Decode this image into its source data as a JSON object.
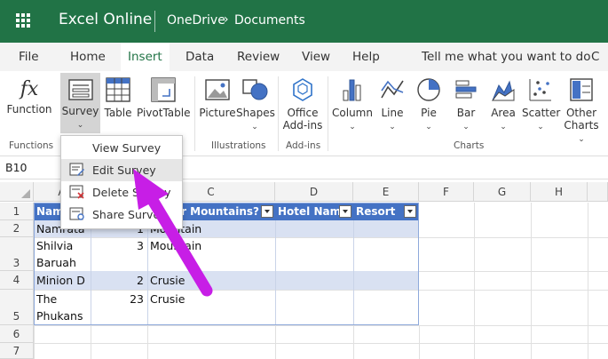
{
  "titlebar": {
    "app_name": "Excel Online",
    "crumb_root": "OneDrive",
    "crumb_separator": "›",
    "crumb_current": "Documents",
    "background": "#217346"
  },
  "tabs": [
    "File",
    "Home",
    "Insert",
    "Data",
    "Review",
    "View",
    "Help"
  ],
  "active_tab": "Insert",
  "tell_me": "Tell me what you want to do",
  "tell_me_trail": "C",
  "ribbon": {
    "function": "Function",
    "survey": "Survey",
    "table": "Table",
    "pivottable": "PivotTable",
    "picture": "Picture",
    "shapes": "Shapes",
    "office_addins_1": "Office",
    "office_addins_2": "Add-ins",
    "column": "Column",
    "line": "Line",
    "pie": "Pie",
    "bar": "Bar",
    "area": "Area",
    "scatter": "Scatter",
    "other_charts_1": "Other",
    "other_charts_2": "Charts",
    "fx_glyph": "fx",
    "caret": "⌄",
    "groups": {
      "functions": "Functions",
      "illustrations": "Illustrations",
      "addins": "Add-ins",
      "charts": "Charts"
    }
  },
  "survey_menu": {
    "items": [
      "View Survey",
      "Edit Survey",
      "Delete Survey",
      "Share Survey"
    ],
    "hovered": "Edit Survey"
  },
  "namebox": "B10",
  "columns": [
    "A",
    "B",
    "C",
    "D",
    "E",
    "F",
    "G",
    "H"
  ],
  "rows": [
    "1",
    "2",
    "3",
    "4",
    "5",
    "6",
    "7"
  ],
  "table": {
    "headers": [
      "Name",
      "",
      "or Mountains?",
      "Hotel Name",
      "Resort"
    ],
    "rows": [
      {
        "a": "Namrata",
        "b": "1",
        "c": "Mountain"
      },
      {
        "a1": "Shilvia",
        "a2": "Baruah",
        "b": "3",
        "c": "Mountain"
      },
      {
        "a": "Minion D",
        "b": "2",
        "c": "Crusie"
      },
      {
        "a1": "The",
        "a2": "Phukans",
        "b": "23",
        "c": "Crusie"
      }
    ],
    "header_color": "#4472c4",
    "band_color": "#d9e1f2"
  },
  "annotation_color": "#c71ee6"
}
